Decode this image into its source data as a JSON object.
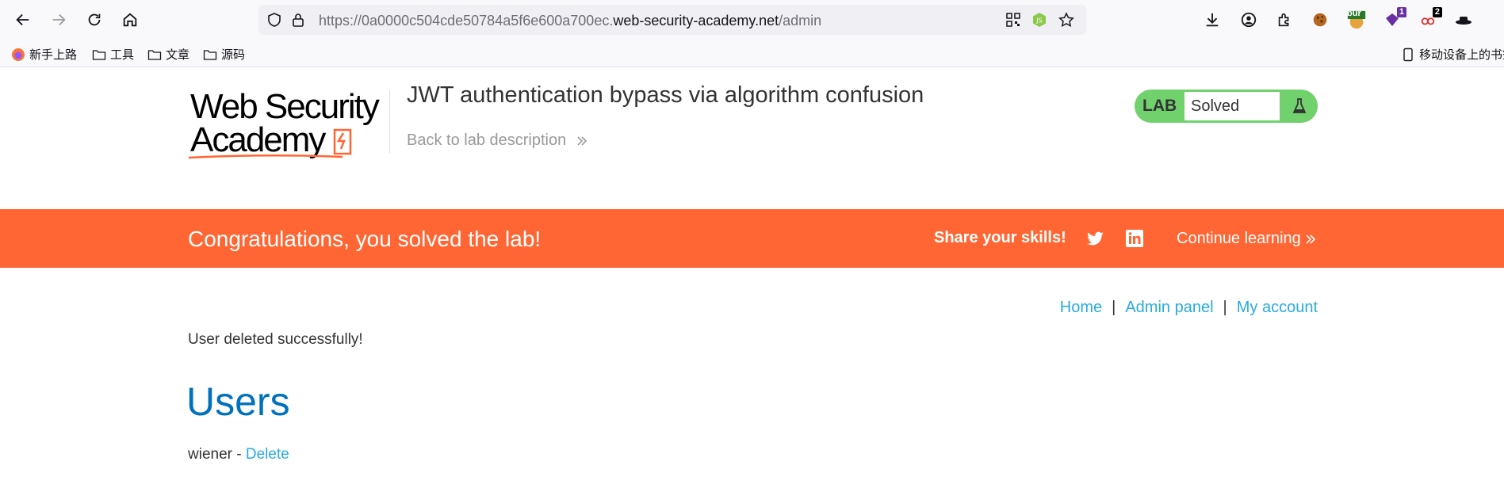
{
  "browser": {
    "url_prefix": "https://0a0000c504cde50784a5f6e600a700ec.",
    "url_host": "web-security-academy.net",
    "url_path": "/admin",
    "extensions": {
      "burp_label": "bur",
      "badge_1": "1",
      "badge_2": "2"
    },
    "bookmarks": [
      {
        "label": "新手上路",
        "icon": "firefox-icon"
      },
      {
        "label": "工具",
        "icon": "folder-icon"
      },
      {
        "label": "文章",
        "icon": "folder-icon"
      },
      {
        "label": "源码",
        "icon": "folder-icon"
      }
    ],
    "mobile_bookmarks": "移动设备上的书签"
  },
  "header": {
    "logo_line1": "Web Security",
    "logo_line2": "Academy",
    "lab_title": "JWT authentication bypass via algorithm confusion",
    "back_link": "Back to lab description",
    "status_label": "LAB",
    "status_value": "Solved"
  },
  "banner": {
    "message": "Congratulations, you solved the lab!",
    "share": "Share your skills!",
    "continue": "Continue learning"
  },
  "nav": {
    "home": "Home",
    "admin": "Admin panel",
    "account": "My account",
    "sep": "|"
  },
  "content": {
    "message": "User deleted successfully!",
    "heading": "Users",
    "users": [
      {
        "name": "wiener",
        "sep": " - ",
        "action": "Delete"
      }
    ]
  },
  "colors": {
    "accent_orange": "#ff6633",
    "link_blue": "#29abe0",
    "heading_blue": "#0071bc",
    "lab_green": "#70d16d"
  }
}
